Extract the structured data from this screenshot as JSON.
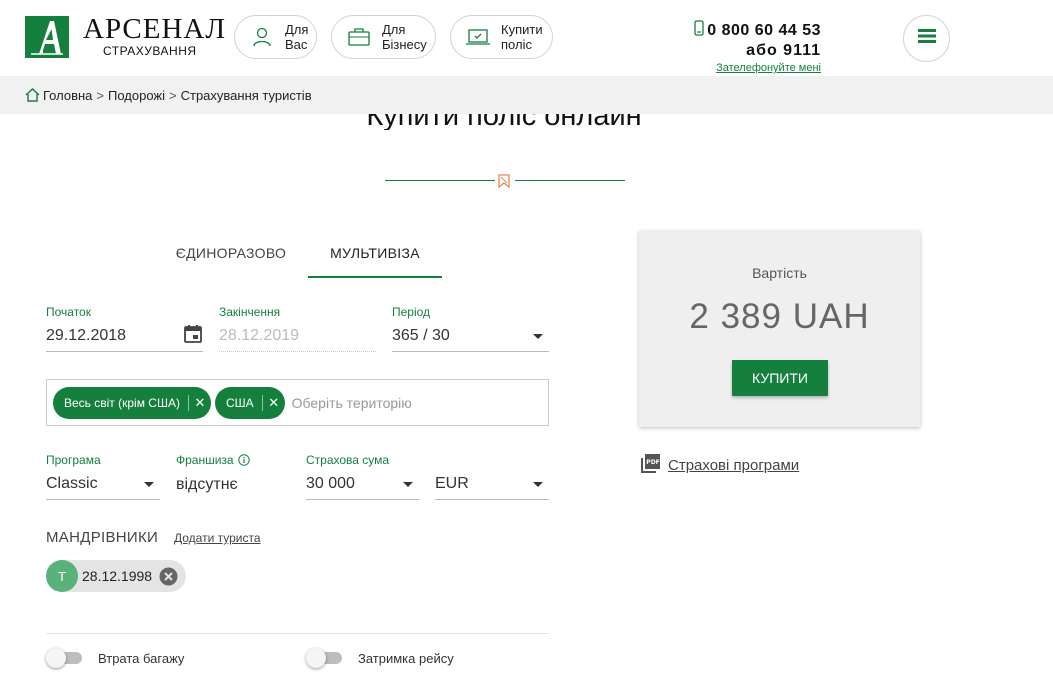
{
  "header": {
    "logo": {
      "title": "АРСЕНАЛ",
      "subtitle": "СТРАХУВАННЯ"
    },
    "nav": [
      {
        "label_line1": "Для",
        "label_line2": "Вас",
        "icon": "person-icon"
      },
      {
        "label_line1": "Для",
        "label_line2": "Бізнесу",
        "icon": "briefcase-icon"
      },
      {
        "label_line1": "Купити",
        "label_line2": "поліс",
        "icon": "laptop-icon"
      }
    ],
    "phone": {
      "main": "0 800 60 44 53",
      "alt": "або 9111",
      "callback": "Зателефонуйте мені"
    }
  },
  "breadcrumb": {
    "items": [
      "Головна",
      "Подорожі",
      "Страхування туристів"
    ],
    "separator": ">"
  },
  "page": {
    "title": "Купити поліс онлайн"
  },
  "tabs": [
    {
      "label": "ЄДИНОРАЗОВО",
      "active": false
    },
    {
      "label": "МУЛЬТИВІЗА",
      "active": true
    }
  ],
  "dates": {
    "start": {
      "label": "Початок",
      "value": "29.12.2018"
    },
    "end": {
      "label": "Закінчення",
      "value": "28.12.2019"
    },
    "period": {
      "label": "Період",
      "value": "365 / 30"
    }
  },
  "territory": {
    "chips": [
      "Весь світ (крім США)",
      "США"
    ],
    "placeholder": "Оберіть територію"
  },
  "program": {
    "program": {
      "label": "Програма",
      "value": "Classic"
    },
    "franchise": {
      "label": "Франшиза",
      "value": "відсутнє"
    },
    "sum": {
      "label": "Страхова сума",
      "value": "30 000"
    },
    "currency": {
      "value": "EUR"
    }
  },
  "travelers": {
    "title": "МАНДРІВНИКИ",
    "add_label": "Додати туриста",
    "items": [
      {
        "initial": "Т",
        "date": "28.12.1998"
      }
    ]
  },
  "options": [
    {
      "label": "Втрата багажу",
      "enabled": false
    },
    {
      "label": "Затримка рейсу",
      "enabled": false
    }
  ],
  "price": {
    "label": "Вартість",
    "value": "2 389 UAH",
    "buy_label": "КУПИТИ"
  },
  "programs_link": "Страхові програми",
  "colors": {
    "brand": "#15803d",
    "avatar": "#58b27a"
  }
}
